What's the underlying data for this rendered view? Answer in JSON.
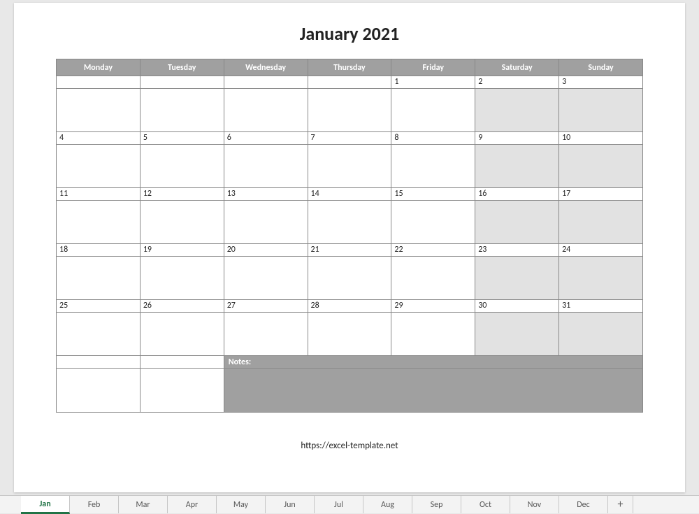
{
  "title": "January 2021",
  "headers": [
    "Monday",
    "Tuesday",
    "Wednesday",
    "Thursday",
    "Friday",
    "Saturday",
    "Sunday"
  ],
  "weeks": [
    [
      {
        "n": "",
        "w": false
      },
      {
        "n": "",
        "w": false
      },
      {
        "n": "",
        "w": false
      },
      {
        "n": "",
        "w": false
      },
      {
        "n": "1",
        "w": false
      },
      {
        "n": "2",
        "w": true
      },
      {
        "n": "3",
        "w": true
      }
    ],
    [
      {
        "n": "4",
        "w": false
      },
      {
        "n": "5",
        "w": false
      },
      {
        "n": "6",
        "w": false
      },
      {
        "n": "7",
        "w": false
      },
      {
        "n": "8",
        "w": false
      },
      {
        "n": "9",
        "w": true
      },
      {
        "n": "10",
        "w": true
      }
    ],
    [
      {
        "n": "11",
        "w": false
      },
      {
        "n": "12",
        "w": false
      },
      {
        "n": "13",
        "w": false
      },
      {
        "n": "14",
        "w": false
      },
      {
        "n": "15",
        "w": false
      },
      {
        "n": "16",
        "w": true
      },
      {
        "n": "17",
        "w": true
      }
    ],
    [
      {
        "n": "18",
        "w": false
      },
      {
        "n": "19",
        "w": false
      },
      {
        "n": "20",
        "w": false
      },
      {
        "n": "21",
        "w": false
      },
      {
        "n": "22",
        "w": false
      },
      {
        "n": "23",
        "w": true
      },
      {
        "n": "24",
        "w": true
      }
    ],
    [
      {
        "n": "25",
        "w": false
      },
      {
        "n": "26",
        "w": false
      },
      {
        "n": "27",
        "w": false
      },
      {
        "n": "28",
        "w": false
      },
      {
        "n": "29",
        "w": false
      },
      {
        "n": "30",
        "w": true
      },
      {
        "n": "31",
        "w": true
      }
    ]
  ],
  "notes_label": "Notes:",
  "footer_url": "https://excel-template.net",
  "tabs": [
    "Jan",
    "Feb",
    "Mar",
    "Apr",
    "May",
    "Jun",
    "Jul",
    "Aug",
    "Sep",
    "Oct",
    "Nov",
    "Dec"
  ],
  "active_tab": "Jan",
  "add_tab_label": "+"
}
